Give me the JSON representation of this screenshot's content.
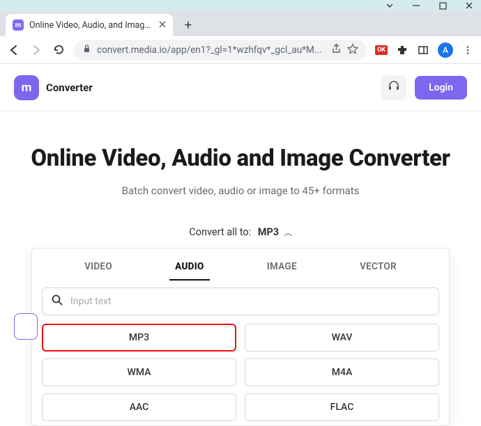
{
  "window": {
    "tab_title": "Online Video, Audio, and Image C"
  },
  "browser": {
    "url": "convert.media.io/app/en1?_gl=1*wzhfqv*_gcl_au*M...",
    "avatar_letter": "A",
    "ext_badge": "OK"
  },
  "app": {
    "logo_letter": "m",
    "name": "Converter",
    "login_label": "Login"
  },
  "hero": {
    "title": "Online Video, Audio and Image Converter",
    "subtitle": "Batch convert video, audio or image to 45+ formats"
  },
  "convert": {
    "prefix": "Convert all to:",
    "selected": "MP3"
  },
  "panel": {
    "tabs": {
      "video": "VIDEO",
      "audio": "AUDIO",
      "image": "IMAGE",
      "vector": "VECTOR"
    },
    "search_placeholder": "Input text",
    "formats": {
      "mp3": "MP3",
      "wav": "WAV",
      "wma": "WMA",
      "m4a": "M4A",
      "aac": "AAC",
      "flac": "FLAC"
    }
  }
}
